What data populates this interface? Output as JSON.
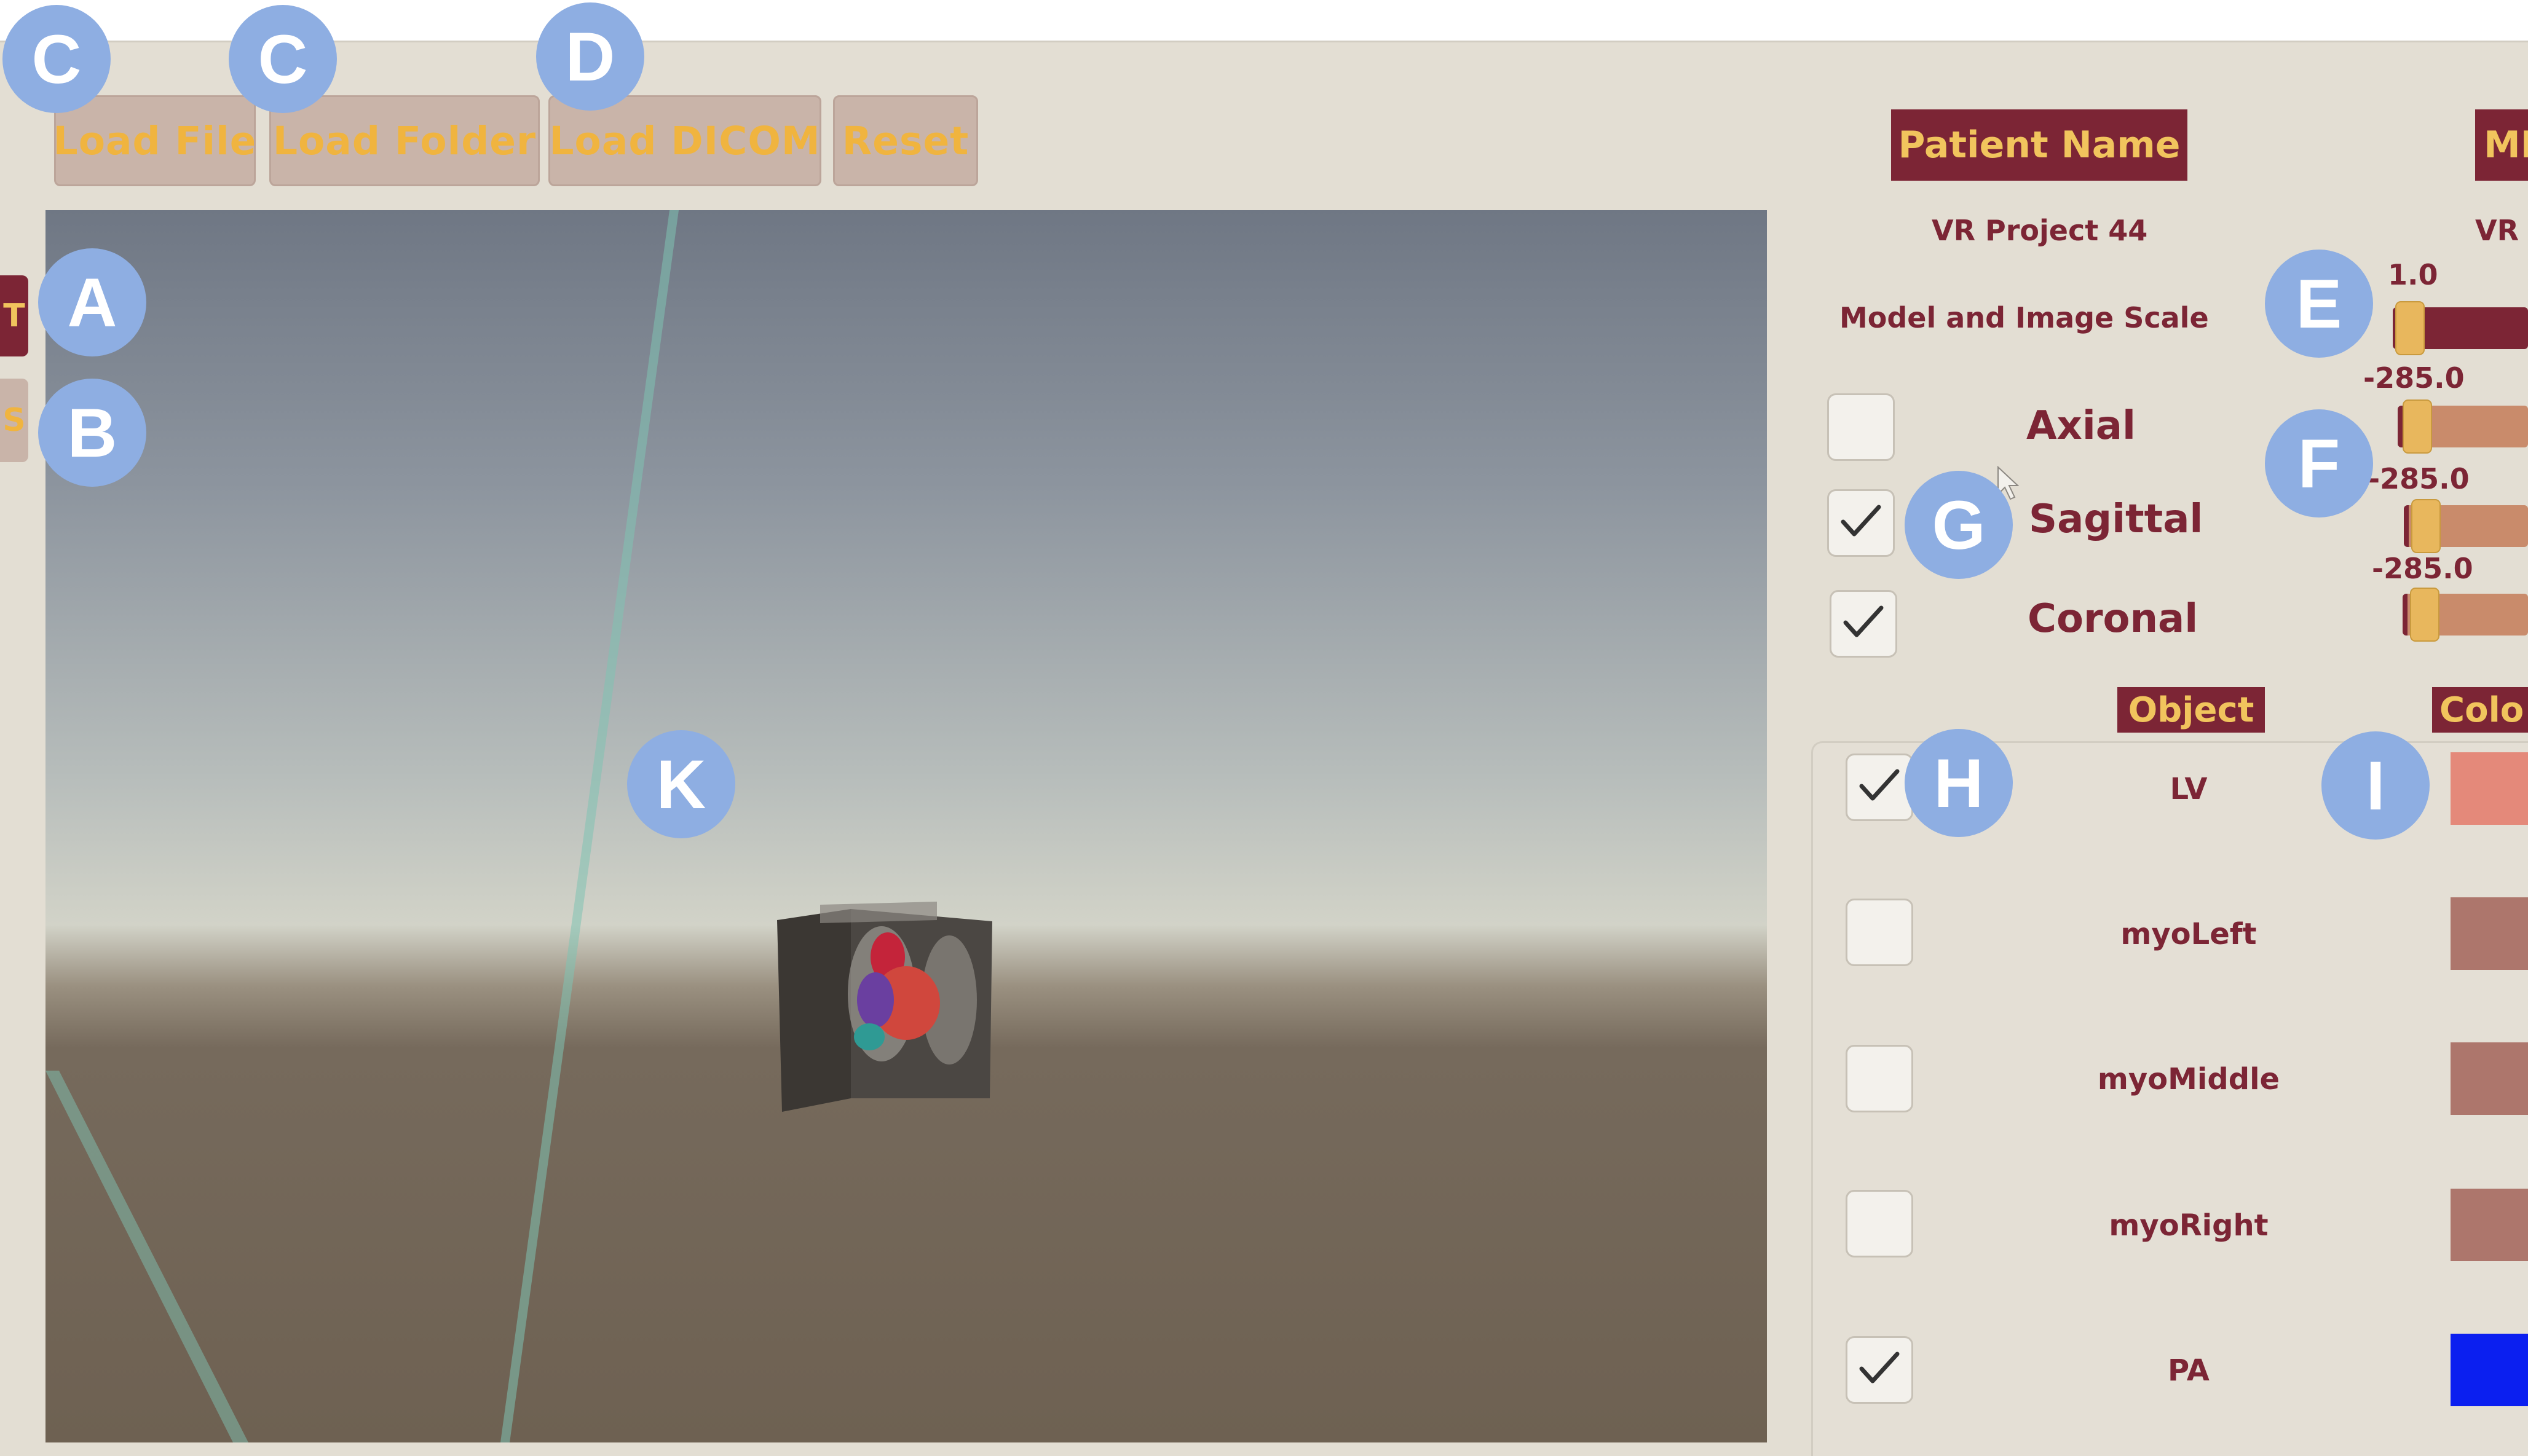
{
  "toolbar": {
    "load_file": "Load File",
    "load_folder": "Load Folder",
    "load_dicom": "Load DICOM",
    "reset": "Reset"
  },
  "side_tabs": {
    "top_letter": "T",
    "bottom_letter": "S"
  },
  "header": {
    "patient_name_label": "Patient Name",
    "patient_name_value": "VR Project 44",
    "second_label_partial": "MR",
    "second_value_partial": "VR"
  },
  "scale": {
    "label": "Model and Image Scale",
    "value": "1.0"
  },
  "planes": [
    {
      "label": "Axial",
      "checked": false,
      "value": "-285.0"
    },
    {
      "label": "Sagittal",
      "checked": true,
      "value": "-285.0"
    },
    {
      "label": "Coronal",
      "checked": true,
      "value": "-285.0"
    }
  ],
  "objects_table": {
    "object_header": "Object",
    "color_header_partial": "Colo",
    "rows": [
      {
        "name": "LV",
        "checked": true,
        "color": "#e4897a"
      },
      {
        "name": "myoLeft",
        "checked": false,
        "color": "#ad766c"
      },
      {
        "name": "myoMiddle",
        "checked": false,
        "color": "#ad766c"
      },
      {
        "name": "myoRight",
        "checked": false,
        "color": "#ad766c"
      },
      {
        "name": "PA",
        "checked": true,
        "color": "#0b1ff0"
      }
    ]
  },
  "markers": {
    "a": "A",
    "b": "B",
    "c1": "C",
    "c2": "C",
    "d": "D",
    "e": "E",
    "f": "F",
    "g": "G",
    "h": "H",
    "i": "I",
    "k": "K"
  },
  "colors": {
    "brand_red": "#7c2535",
    "accent_gold": "#f1c45d",
    "marker_blue": "#8eaee2",
    "app_bg": "#e3ded3"
  }
}
